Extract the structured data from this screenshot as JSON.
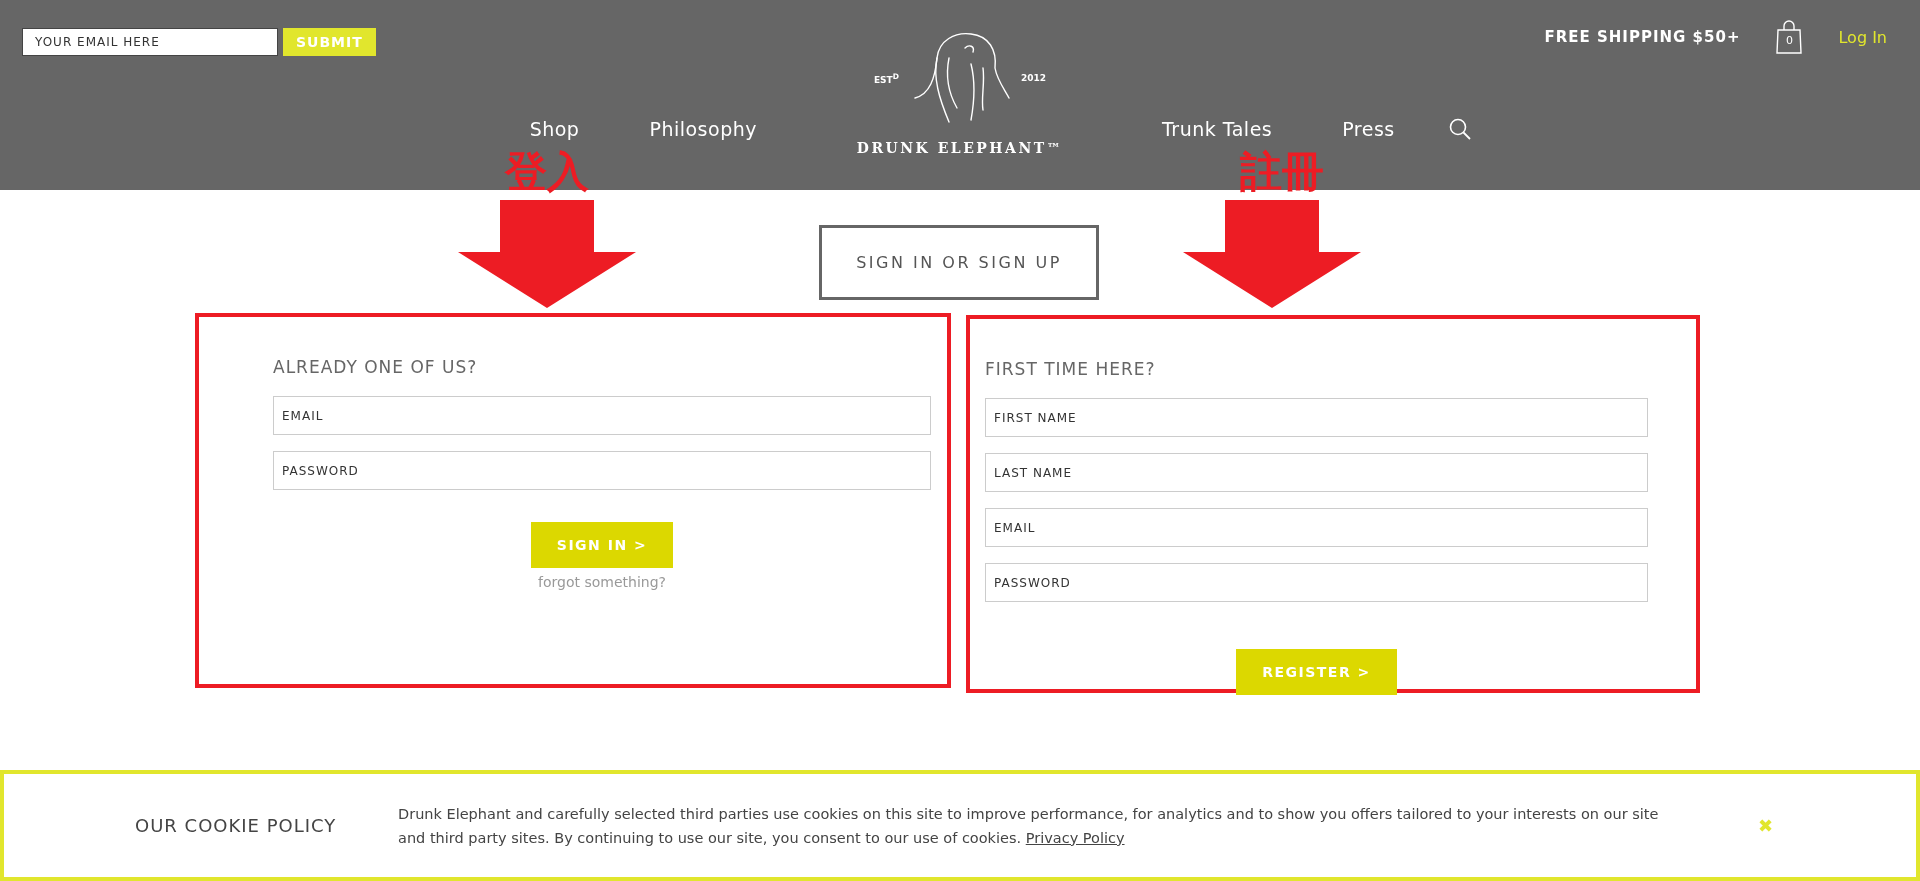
{
  "header": {
    "newsletter": {
      "placeholder": "YOUR EMAIL HERE",
      "button": "SUBMIT"
    },
    "logo": {
      "estd": "EST$^{D}$",
      "year": "2012",
      "name": "DRUNK ELEPHANT™"
    },
    "nav_left": [
      "Shop",
      "Philosophy"
    ],
    "nav_right": [
      "Trunk Tales",
      "Press"
    ],
    "shipping": "FREE SHIPPING $50+",
    "cart_count": "0",
    "login": "Log In"
  },
  "annotations": [
    {
      "label": "登入"
    },
    {
      "label": "註冊"
    }
  ],
  "title": "SIGN IN OR SIGN UP",
  "sign_in": {
    "heading": "ALREADY ONE OF US?",
    "fields": [
      {
        "placeholder": "EMAIL"
      },
      {
        "placeholder": "PASSWORD"
      }
    ],
    "button": "SIGN IN >",
    "link": "forgot something?"
  },
  "register": {
    "heading": "FIRST TIME HERE?",
    "fields": [
      {
        "placeholder": "FIRST NAME"
      },
      {
        "placeholder": "LAST NAME"
      },
      {
        "placeholder": "EMAIL"
      },
      {
        "placeholder": "PASSWORD"
      }
    ],
    "button": "REGISTER >"
  },
  "cookie": {
    "title": "OUR COOKIE POLICY",
    "text": "Drunk Elephant and carefully selected third parties use cookies on this site to improve performance, for analytics and to show you offers tailored to your interests on our site and third party sites. By continuing to use our site, you consent to our use of cookies.",
    "link": "Privacy Policy",
    "close": "✖"
  }
}
